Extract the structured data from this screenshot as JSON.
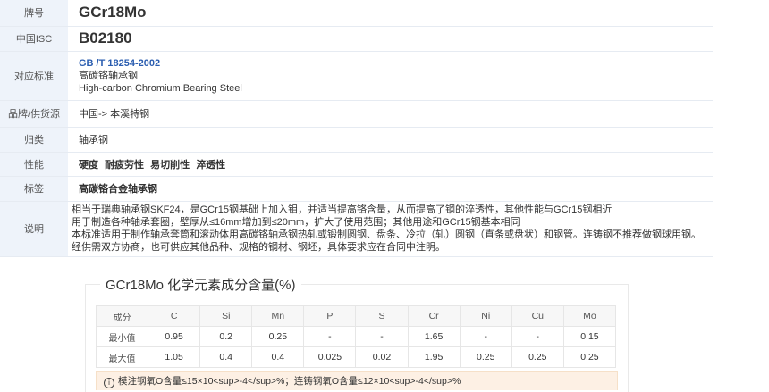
{
  "info": {
    "grade": {
      "label": "牌号",
      "value": "GCr18Mo"
    },
    "isc": {
      "label": "中国ISC",
      "value": "B02180"
    },
    "standard": {
      "label": "对应标准",
      "code": "GB /T 18254-2002",
      "name_cn": "高碳铬轴承钢",
      "name_en": "High-carbon Chromium Bearing Steel"
    },
    "brand": {
      "label": "品牌/供货源",
      "value": "中国-> 本溪特钢"
    },
    "category": {
      "label": "归类",
      "value": "轴承钢"
    },
    "properties": {
      "label": "性能",
      "items": [
        "硬度",
        "耐疲劳性",
        "易切削性",
        "淬透性"
      ]
    },
    "tags": {
      "label": "标签",
      "items": [
        "高碳铬合金轴承钢"
      ]
    },
    "description": {
      "label": "说明",
      "lines": [
        "相当于瑞典轴承钢SKF24，是GCr15钢基础上加入钼，并适当提高铬含量，从而提高了钢的淬透性，其他性能与GCr15钢相近",
        "用于制造各种轴承套圈，壁厚从≤16mm增加到≤20mm，扩大了使用范围；其他用途和GCr15钢基本相同",
        "本标准适用于制作轴承套筒和滚动体用高碳铬轴承钢热轧或锻制圆钢、盘条、冷拉（轧）圆钢（直条或盘状）和钢管。连铸钢不推荐做钢球用钢。",
        "经供需双方协商，也可供应其他品种、规格的钢材、钢坯，具体要求应在合同中注明。"
      ]
    }
  },
  "composition": {
    "title": "GCr18Mo 化学元素成分含量(%)",
    "header_label": "成分",
    "elements": [
      "C",
      "Si",
      "Mn",
      "P",
      "S",
      "Cr",
      "Ni",
      "Cu",
      "Mo"
    ],
    "rows": [
      {
        "label": "最小值",
        "values": [
          "0.95",
          "0.2",
          "0.25",
          "-",
          "-",
          "1.65",
          "-",
          "-",
          "0.15"
        ]
      },
      {
        "label": "最大值",
        "values": [
          "1.05",
          "0.4",
          "0.4",
          "0.025",
          "0.02",
          "1.95",
          "0.25",
          "0.25",
          "0.25"
        ]
      }
    ],
    "note_icon": "info-icon",
    "note": "模注钢氧O含量≤15×10<sup>-4</sup>%；连铸钢氧O含量≤12×10<sup>-4</sup>%"
  },
  "colors": {
    "label_bg": "#eef3fa",
    "link": "#2a5db0",
    "note_bg": "#fdf0e4"
  }
}
